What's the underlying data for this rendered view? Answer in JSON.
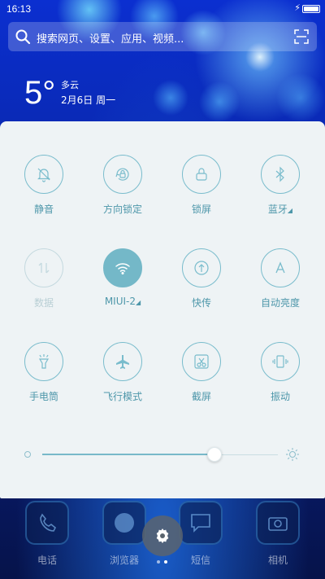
{
  "status_bar": {
    "time": "16:13",
    "charging_icon": "lightning-icon",
    "battery_icon": "battery-icon"
  },
  "search": {
    "placeholder": "搜索网页、设置、应用、视频...",
    "icon": "search-icon",
    "scan_icon": "scan-icon"
  },
  "weather": {
    "temperature": "5°",
    "condition": "多云",
    "date": "2月6日 周一"
  },
  "toggles": [
    {
      "label": "静音",
      "icon": "bell-off-icon",
      "state": "off"
    },
    {
      "label": "方向锁定",
      "icon": "rotation-lock-icon",
      "state": "off"
    },
    {
      "label": "锁屏",
      "icon": "lock-icon",
      "state": "off"
    },
    {
      "label": "蓝牙",
      "icon": "bluetooth-icon",
      "state": "off",
      "has_menu": true
    },
    {
      "label": "数据",
      "icon": "mobile-data-icon",
      "state": "disabled"
    },
    {
      "label": "MIUI-2",
      "icon": "wifi-icon",
      "state": "on",
      "has_menu": true
    },
    {
      "label": "快传",
      "icon": "quick-transfer-icon",
      "state": "off"
    },
    {
      "label": "自动亮度",
      "icon": "auto-brightness-icon",
      "state": "off"
    },
    {
      "label": "手电筒",
      "icon": "flashlight-icon",
      "state": "off"
    },
    {
      "label": "飞行模式",
      "icon": "airplane-icon",
      "state": "off"
    },
    {
      "label": "截屏",
      "icon": "screenshot-icon",
      "state": "off"
    },
    {
      "label": "振动",
      "icon": "vibrate-icon",
      "state": "off"
    }
  ],
  "brightness": {
    "level": 0.73
  },
  "dock": [
    {
      "label": "电话",
      "icon": "phone-icon"
    },
    {
      "label": "浏览器",
      "icon": "browser-icon"
    },
    {
      "label": "短信",
      "icon": "message-icon"
    },
    {
      "label": "相机",
      "icon": "camera-icon"
    }
  ],
  "settings": {
    "icon": "gear-icon"
  },
  "colors": {
    "accent": "#74b8c8",
    "panel_bg": "#eef3f5",
    "label": "#4e97aa"
  }
}
